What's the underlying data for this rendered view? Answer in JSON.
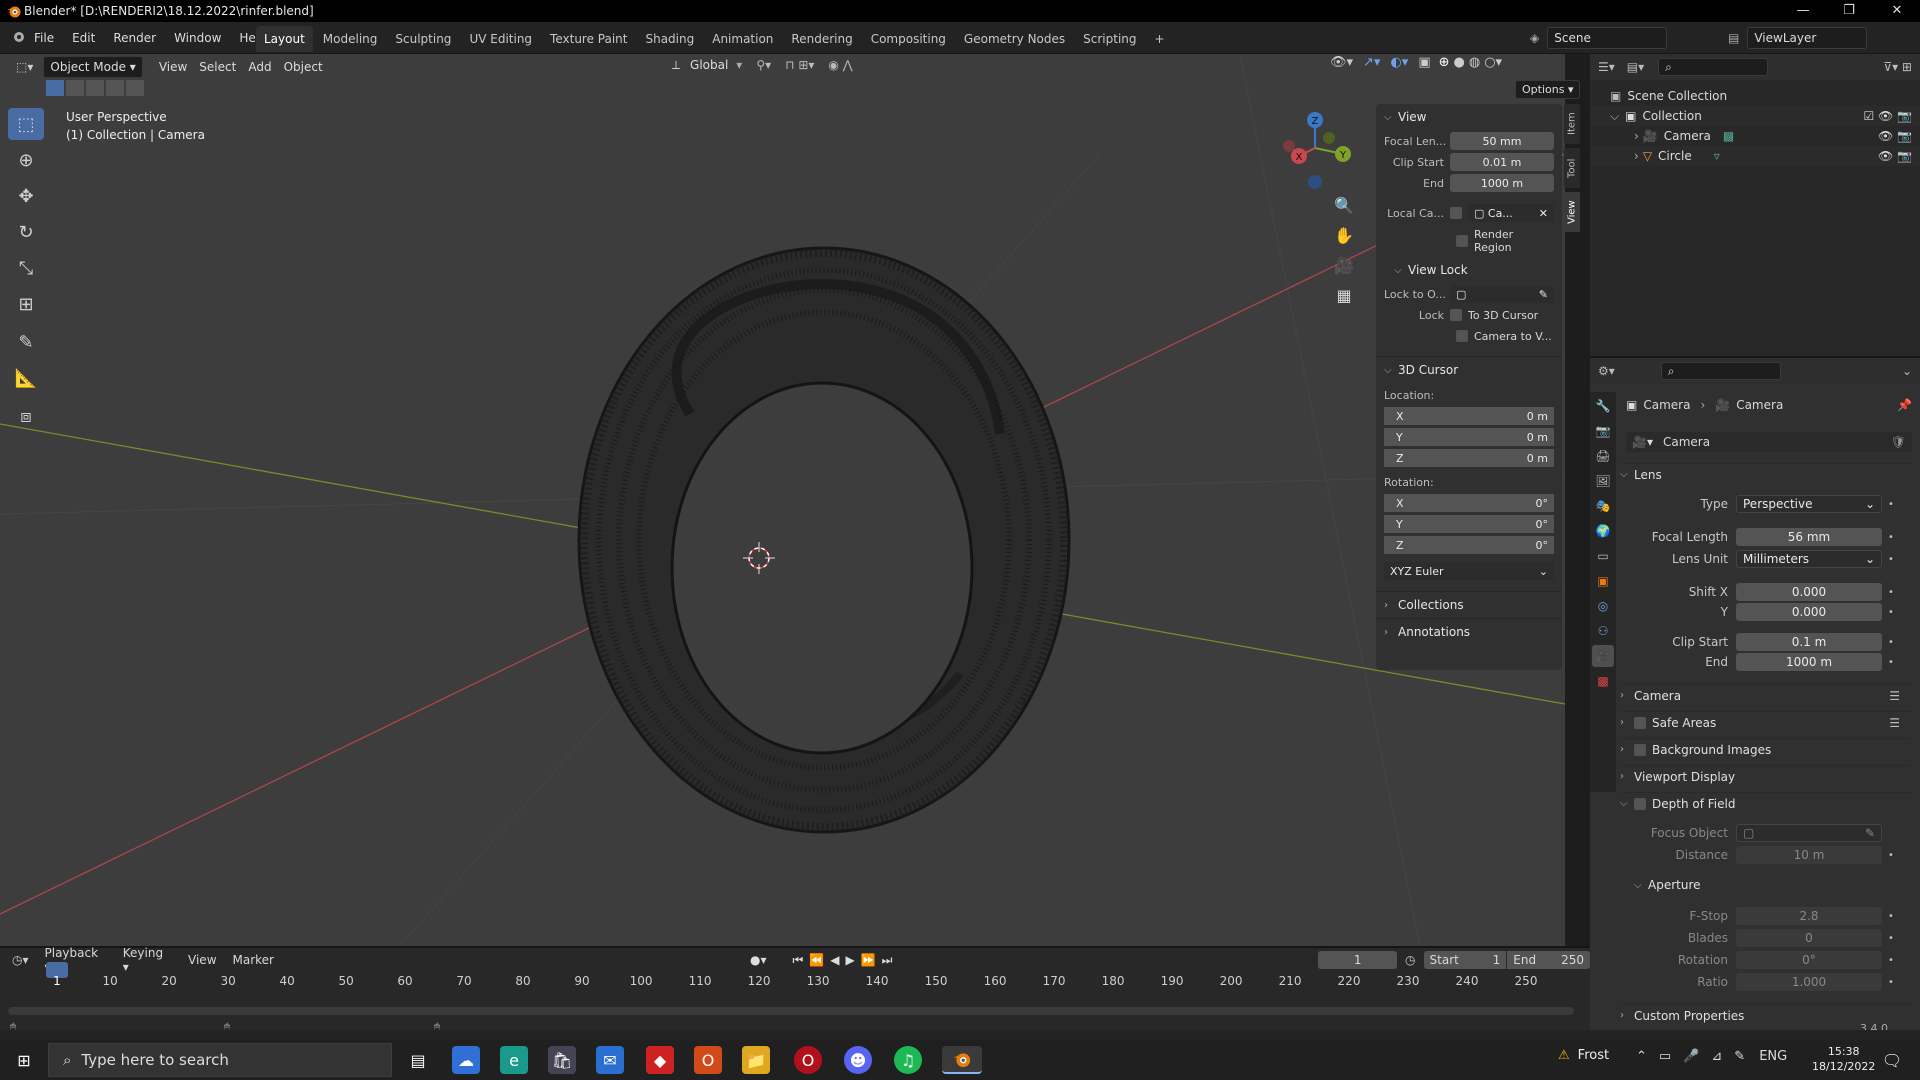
{
  "window": {
    "title": "Blender* [D:\\RENDERI2\\18.12.2022\\rinfer.blend]",
    "minimize": "—",
    "maximize": "❐",
    "close": "✕"
  },
  "menu": [
    "File",
    "Edit",
    "Render",
    "Window",
    "Help"
  ],
  "workspaces": [
    "Layout",
    "Modeling",
    "Sculpting",
    "UV Editing",
    "Texture Paint",
    "Shading",
    "Animation",
    "Rendering",
    "Compositing",
    "Geometry Nodes",
    "Scripting",
    "+"
  ],
  "active_workspace": "Layout",
  "scene": {
    "label": "Scene",
    "viewlayer": "ViewLayer"
  },
  "viewport_header": {
    "mode": "Object Mode",
    "menus": [
      "View",
      "Select",
      "Add",
      "Object"
    ],
    "transform": "Global",
    "options": "Options"
  },
  "viewport_overlay": {
    "line1": "User Perspective",
    "line2": "(1) Collection | Camera",
    "gizmo_x": "X",
    "gizmo_y": "Y",
    "gizmo_z": "Z"
  },
  "npanel": {
    "tabs": [
      "Item",
      "Tool",
      "View"
    ],
    "view": {
      "header": "View",
      "focal_label": "Focal Len...",
      "focal_value": "50 mm",
      "clip_start_label": "Clip Start",
      "clip_start_value": "0.01 m",
      "end_label": "End",
      "end_value": "1000 m",
      "local_cam_label": "Local Ca...",
      "local_cam_value": "Ca...",
      "render_region": "Render Region"
    },
    "view_lock": {
      "header": "View Lock",
      "lock_to_label": "Lock to O...",
      "lock_label": "Lock",
      "to_cursor": "To 3D Cursor",
      "camera_to_view": "Camera to V..."
    },
    "cursor": {
      "header": "3D Cursor",
      "location_label": "Location:",
      "loc": [
        {
          "axis": "X",
          "value": "0 m"
        },
        {
          "axis": "Y",
          "value": "0 m"
        },
        {
          "axis": "Z",
          "value": "0 m"
        }
      ],
      "rotation_label": "Rotation:",
      "rot": [
        {
          "axis": "X",
          "value": "0°"
        },
        {
          "axis": "Y",
          "value": "0°"
        },
        {
          "axis": "Z",
          "value": "0°"
        }
      ],
      "mode": "XYZ Euler"
    },
    "collections": "Collections",
    "annotations": "Annotations"
  },
  "outliner": {
    "scene_collection": "Scene Collection",
    "collection": "Collection",
    "camera": "Camera",
    "circle": "Circle"
  },
  "properties": {
    "breadcrumb_obj": "Camera",
    "breadcrumb_data": "Camera",
    "datablock": "Camera",
    "lens_header": "Lens",
    "type_label": "Type",
    "type_value": "Perspective",
    "focal_label": "Focal Length",
    "focal_value": "56 mm",
    "lens_unit_label": "Lens Unit",
    "lens_unit_value": "Millimeters",
    "shiftx_label": "Shift X",
    "shiftx_value": "0.000",
    "shifty_label": "Y",
    "shifty_value": "0.000",
    "clip_start_label": "Clip Start",
    "clip_start_value": "0.1 m",
    "clip_end_label": "End",
    "clip_end_value": "1000 m",
    "sections": [
      "Camera",
      "Safe Areas",
      "Background Images",
      "Viewport Display",
      "Depth of Field"
    ],
    "focus_object_label": "Focus Object",
    "distance_label": "Distance",
    "distance_value": "10 m",
    "aperture_header": "Aperture",
    "fstop_label": "F-Stop",
    "fstop_value": "2.8",
    "blades_label": "Blades",
    "blades_value": "0",
    "rotation_label": "Rotation",
    "rotation_value": "0°",
    "ratio_label": "Ratio",
    "ratio_value": "1.000",
    "custom_props": "Custom Properties",
    "version": "3.4.0"
  },
  "timeline": {
    "menus": [
      "Playback",
      "Keying",
      "View",
      "Marker"
    ],
    "current_frame": "1",
    "start_label": "Start",
    "start_value": "1",
    "end_label": "End",
    "end_value": "250",
    "ticks": [
      "1",
      "10",
      "20",
      "30",
      "40",
      "50",
      "60",
      "70",
      "80",
      "90",
      "100",
      "110",
      "120",
      "130",
      "140",
      "150",
      "160",
      "170",
      "180",
      "190",
      "200",
      "210",
      "220",
      "230",
      "240",
      "250"
    ]
  },
  "taskbar": {
    "search_placeholder": "Type here to search",
    "weather": "Frost",
    "lang": "ENG",
    "time": "15:38",
    "date": "18/12/2022"
  },
  "colors": {
    "accent": "#4a6ca4",
    "x_axis": "#c9484f",
    "y_axis": "#7ea22b",
    "z_axis": "#3c78c8",
    "object_mesh": "#161616"
  }
}
